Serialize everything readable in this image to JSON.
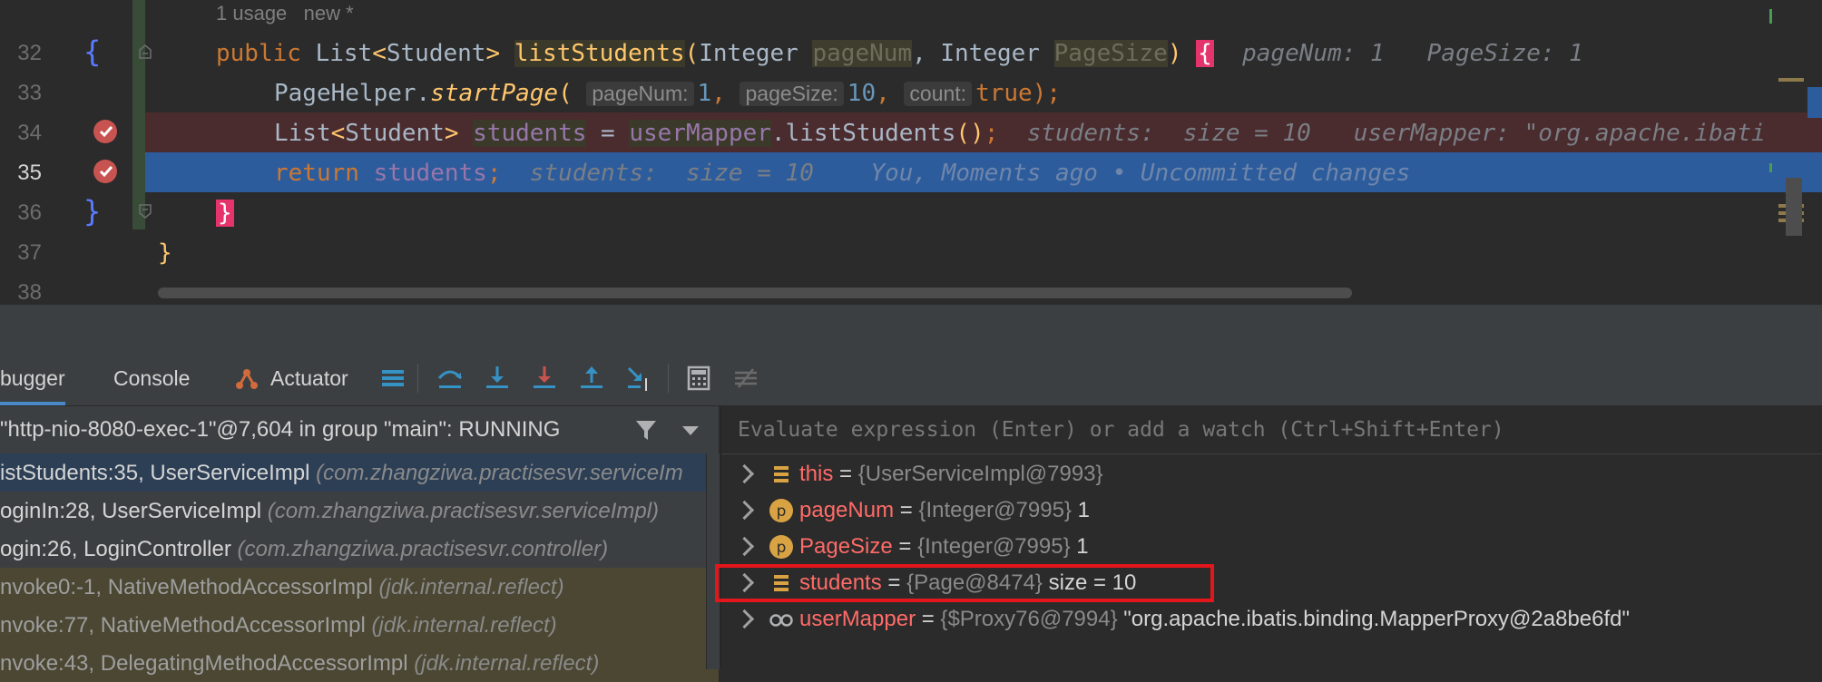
{
  "editor": {
    "usage_hint": "1 usage   new *",
    "line_numbers": [
      "32",
      "33",
      "34",
      "35",
      "36",
      "37",
      "38"
    ],
    "current_line": "35",
    "line32": {
      "public": "public ",
      "ret_type": "List",
      "generic_open": "<",
      "generic_type": "Student",
      "generic_close": ">",
      "method": "listStudents",
      "paren_open": "(",
      "type1": "Integer ",
      "param1": "pageNum",
      "comma": ", ",
      "type2": "Integer ",
      "param2": "PageSize",
      "paren_close": ") ",
      "brace": "{",
      "dbg1": "pageNum: 1",
      "dbg2": "PageSize: 1"
    },
    "line33": {
      "cls": "PageHelper.",
      "method": "startPage",
      "paren_open": "(",
      "hint1": "pageNum:",
      "val1": "1",
      "sep1": ", ",
      "hint2": "pageSize:",
      "val2": "10",
      "sep2": ", ",
      "hint3": "count:",
      "val3": "true",
      "end": ");"
    },
    "line34": {
      "type": "List",
      "generic_open": "<",
      "generic_type": "Student",
      "generic_close": ">",
      "var": "students",
      "assign": " = ",
      "field": "userMapper",
      "call": ".listStudents",
      "parens": "()",
      "semi": ";",
      "dbg1": "students:  size = 10",
      "dbg2": "userMapper: \"org.apache.ibati"
    },
    "line35": {
      "kw": "return ",
      "var": "students",
      "semi": ";",
      "dbg": "students:  size = 10",
      "blame": "You, Moments ago • Uncommitted changes"
    },
    "line36": {
      "brace": "}"
    },
    "line37": {
      "brace": "}"
    }
  },
  "toolbar": {
    "tabs": [
      "bugger",
      "Console",
      "Actuator"
    ],
    "icons": [
      "frames-menu-icon",
      "step-over-icon",
      "step-into-icon",
      "force-step-into-icon",
      "step-out-icon",
      "run-to-cursor-icon",
      "evaluate-icon",
      "trace-icon"
    ]
  },
  "frames": {
    "thread": "\"http-nio-8080-exec-1\"@7,604 in group \"main\": RUNNING",
    "items": [
      {
        "method": "istStudents:35, UserServiceImpl ",
        "pkg": "(com.zhangziwa.practisesvr.serviceIm"
      },
      {
        "method": "oginIn:28, UserServiceImpl ",
        "pkg": "(com.zhangziwa.practisesvr.serviceImpl)"
      },
      {
        "method": "ogin:26, LoginController ",
        "pkg": "(com.zhangziwa.practisesvr.controller)"
      },
      {
        "method": "nvoke0:-1, NativeMethodAccessorImpl ",
        "pkg": "(jdk.internal.reflect)"
      },
      {
        "method": "nvoke:77, NativeMethodAccessorImpl ",
        "pkg": "(jdk.internal.reflect)"
      },
      {
        "method": "nvoke:43, DelegatingMethodAccessorImpl ",
        "pkg": "(jdk.internal.reflect)"
      }
    ]
  },
  "variables": {
    "eval_placeholder": "Evaluate expression (Enter) or add a watch (Ctrl+Shift+Enter)",
    "items": [
      {
        "name": "this",
        "eq": " = ",
        "ref": "{UserServiceImpl@7993}",
        "value": ""
      },
      {
        "name": "pageNum",
        "eq": " = ",
        "ref": "{Integer@7995}",
        "value": " 1"
      },
      {
        "name": "PageSize",
        "eq": " = ",
        "ref": "{Integer@7995}",
        "value": " 1"
      },
      {
        "name": "students",
        "eq": " = ",
        "ref": "{Page@8474}",
        "value": "  size = 10"
      },
      {
        "name": "userMapper",
        "eq": " = ",
        "ref": "{$Proxy76@7994}",
        "value": " \"org.apache.ibatis.binding.MapperProxy@2a8be6fd\""
      }
    ],
    "param_badge": "p"
  },
  "colors": {
    "breakpoint": "#c75450",
    "selection": "#2d5c9c",
    "highlight": "#e3161c"
  }
}
